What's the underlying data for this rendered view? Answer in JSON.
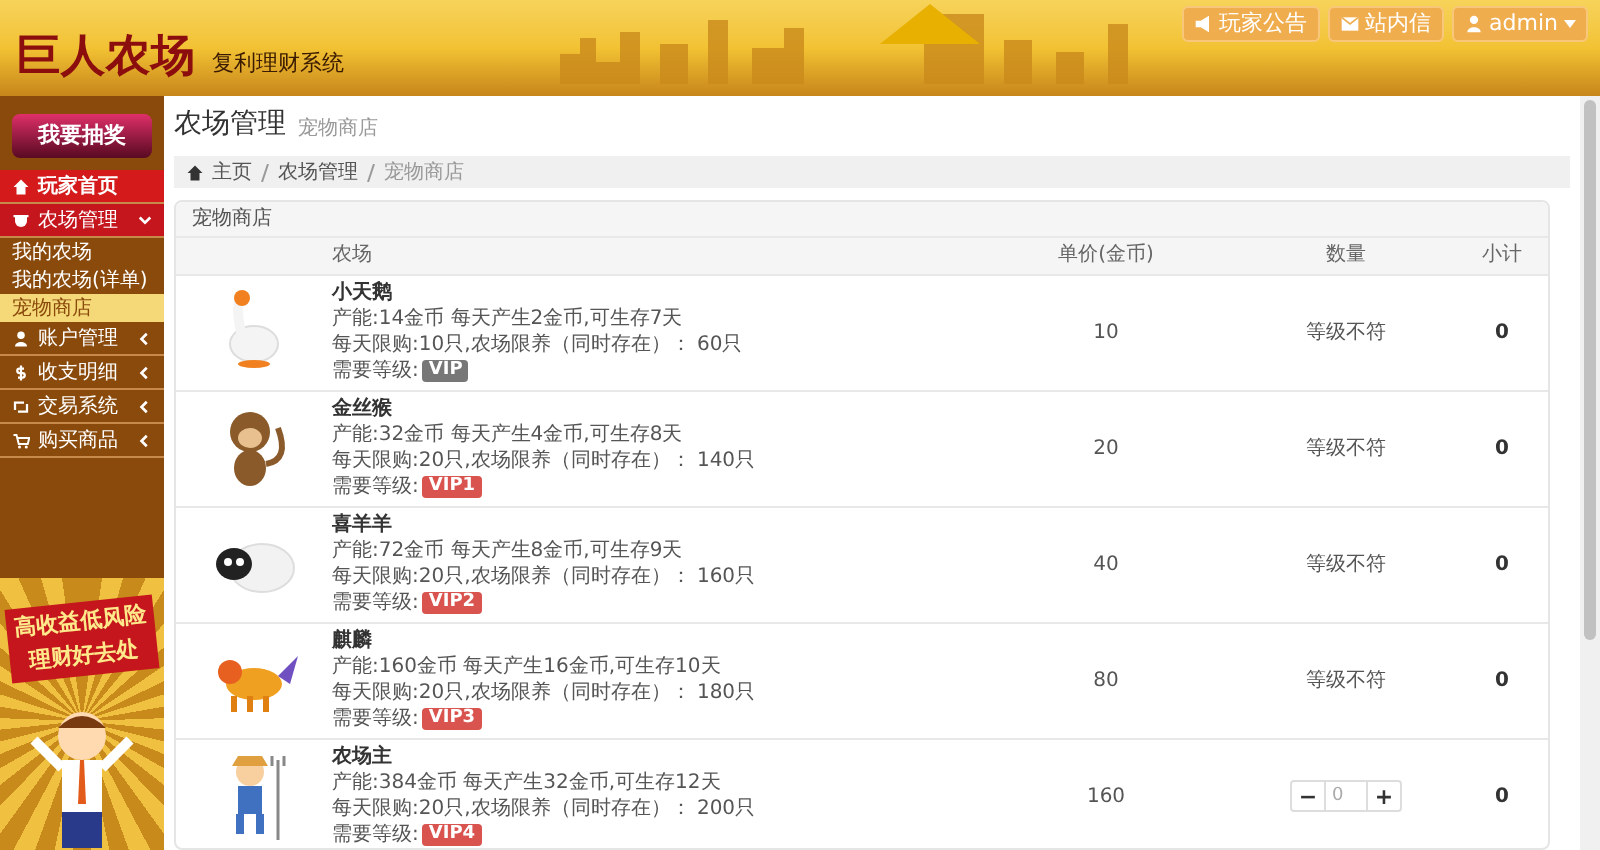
{
  "header": {
    "logo": "巨人农场",
    "subtitle": "复利理财系统",
    "buttons": [
      {
        "kind": "notice",
        "label": "玩家公告"
      },
      {
        "kind": "mail",
        "label": "站内信"
      },
      {
        "kind": "user",
        "label": "admin"
      }
    ]
  },
  "sidebar": {
    "lottery_button": "我要抽奖",
    "items": [
      {
        "label": "玩家首页",
        "selected": true
      },
      {
        "label": "农场管理",
        "selected": false,
        "expanded": true,
        "children": [
          {
            "label": "我的农场",
            "selected": false
          },
          {
            "label": "我的农场(详单)",
            "selected": false
          },
          {
            "label": "宠物商店",
            "selected": true
          }
        ]
      },
      {
        "label": "账户管理",
        "selected": false
      },
      {
        "label": "收支明细",
        "selected": false
      },
      {
        "label": "交易系统",
        "selected": false
      },
      {
        "label": "购买商品",
        "selected": false
      }
    ],
    "banner": {
      "line_1": "高收益低风险",
      "line_2": "理财好去处"
    }
  },
  "page": {
    "title": "农场管理",
    "subtitle": "宠物商店",
    "breadcrumb": [
      "主页",
      "农场管理",
      "宠物商店"
    ]
  },
  "panel": {
    "title": "宠物商店",
    "table": {
      "columns": [
        "农场",
        "单价(金币)",
        "数量",
        "小计"
      ],
      "rows": [
        {
          "name": "小天鹅",
          "output": "产能:14金币 每天产生2金币,可生存7天",
          "limit": "每天限购:10只,农场限养（同时存在）： 60只",
          "level_label": "需要等级:",
          "level": "VIP",
          "color": "#777777",
          "price": "10",
          "quantity": {
            "kind": "text",
            "text": "等级不符"
          },
          "subtotal": "0"
        },
        {
          "name": "金丝猴",
          "output": "产能:32金币 每天产生4金币,可生存8天",
          "limit": "每天限购:20只,农场限养（同时存在）： 140只",
          "level_label": "需要等级:",
          "level": "VIP1",
          "color": "#d9534f",
          "price": "20",
          "quantity": {
            "kind": "text",
            "text": "等级不符"
          },
          "subtotal": "0"
        },
        {
          "name": "喜羊羊",
          "output": "产能:72金币 每天产生8金币,可生存9天",
          "limit": "每天限购:20只,农场限养（同时存在）： 160只",
          "level_label": "需要等级:",
          "level": "VIP2",
          "color": "#d9534f",
          "price": "40",
          "quantity": {
            "kind": "text",
            "text": "等级不符"
          },
          "subtotal": "0"
        },
        {
          "name": "麒麟",
          "output": "产能:160金币 每天产生16金币,可生存10天",
          "limit": "每天限购:20只,农场限养（同时存在）： 180只",
          "level_label": "需要等级:",
          "level": "VIP3",
          "color": "#d9534f",
          "price": "80",
          "quantity": {
            "kind": "text",
            "text": "等级不符"
          },
          "subtotal": "0"
        },
        {
          "name": "农场主",
          "output": "产能:384金币 每天产生32金币,可生存12天",
          "limit": "每天限购:20只,农场限养（同时存在）： 200只",
          "level_label": "需要等级:",
          "level": "VIP4",
          "color": "#d9534f",
          "price": "160",
          "quantity": {
            "kind": "stepper",
            "minus": "−",
            "value": "0",
            "plus": "+"
          },
          "subtotal": "0"
        }
      ]
    }
  }
}
